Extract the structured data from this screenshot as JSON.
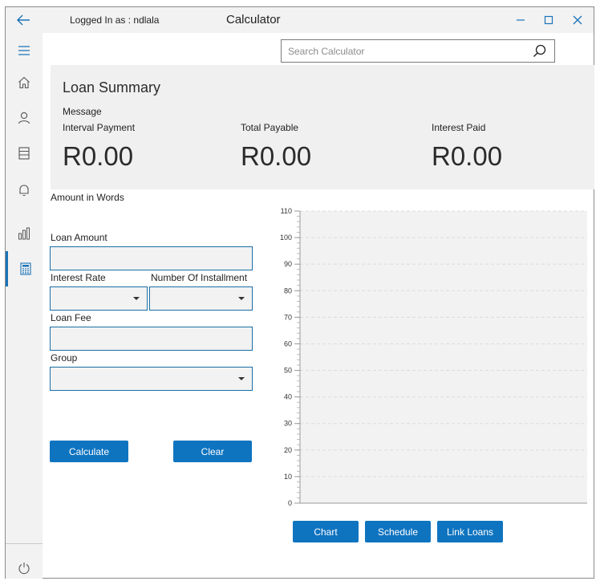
{
  "window": {
    "logged_in_text": "Logged In as : ndlala",
    "title": "Calculator"
  },
  "search": {
    "placeholder": "Search Calculator"
  },
  "summary": {
    "title": "Loan Summary",
    "message_label": "Message",
    "interval_label": "Interval Payment",
    "interval_value": "R0.00",
    "total_label": "Total Payable",
    "total_value": "R0.00",
    "interest_label": "Interest Paid",
    "interest_value": "R0.00"
  },
  "form": {
    "amount_words_label": "Amount in Words",
    "loan_amount_label": "Loan Amount",
    "loan_amount_value": "",
    "interest_rate_label": "Interest Rate",
    "installments_label": "Number Of Installment",
    "loan_fee_label": "Loan Fee",
    "loan_fee_value": "",
    "group_label": "Group",
    "calculate_label": "Calculate",
    "clear_label": "Clear"
  },
  "nav": {
    "items": [
      "menu-icon",
      "home-icon",
      "person-icon",
      "list-icon",
      "bell-icon",
      "bar-chart-icon",
      "calculator-icon"
    ],
    "active": "calculator-icon",
    "footer": "power-icon"
  },
  "chart_data": {
    "type": "bar",
    "categories": [],
    "values": [],
    "ylim": [
      0,
      110
    ],
    "yticks": [
      0,
      10,
      20,
      30,
      40,
      50,
      60,
      70,
      80,
      90,
      100,
      110
    ],
    "grid": true
  },
  "chart_buttons": {
    "chart_label": "Chart",
    "schedule_label": "Schedule",
    "link_loans_label": "Link Loans"
  },
  "colors": {
    "accent": "#0f74c0",
    "panel": "#f0f0f0",
    "field_border": "#1a6fa6"
  }
}
